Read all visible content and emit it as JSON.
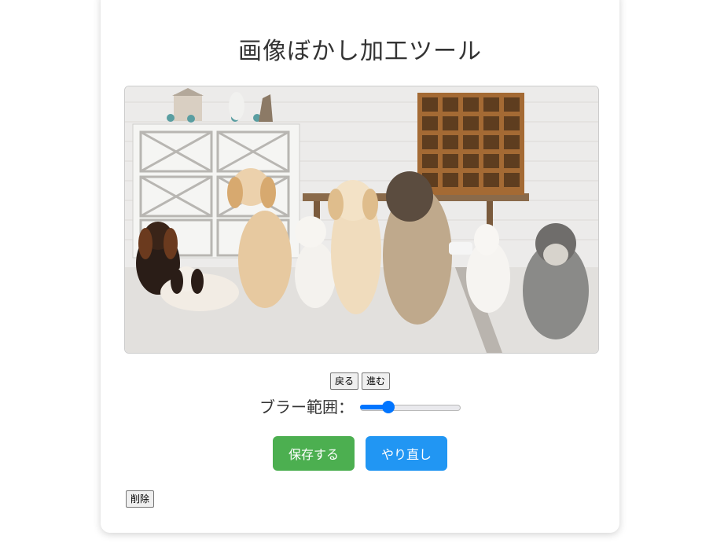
{
  "page": {
    "title": "画像ぼかし加工ツール"
  },
  "image": {
    "alt": "dogs"
  },
  "history": {
    "back_label": "戻る",
    "forward_label": "進む"
  },
  "blur": {
    "label": "ブラー範囲：",
    "value": 0.25
  },
  "actions": {
    "save_label": "保存する",
    "redo_label": "やり直し"
  },
  "delete_label": "削除",
  "colors": {
    "save": "#4caf50",
    "redo": "#2196f3",
    "slider": "#0075ff"
  }
}
